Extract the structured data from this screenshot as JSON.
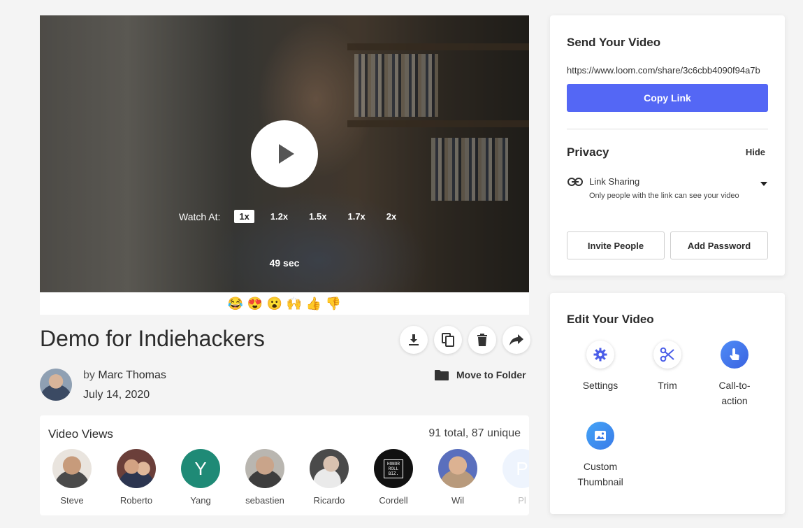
{
  "player": {
    "watch_at_label": "Watch At:",
    "speeds": [
      "1x",
      "1.2x",
      "1.5x",
      "1.7x",
      "2x"
    ],
    "active_speed": "1x",
    "duration": "49 sec"
  },
  "reactions": [
    "😂",
    "😍",
    "😮",
    "🙌",
    "👍",
    "👎"
  ],
  "video": {
    "title": "Demo for Indiehackers",
    "by_label": "by",
    "author": "Marc Thomas",
    "date": "July 14, 2020",
    "move_to_folder": "Move to Folder"
  },
  "views": {
    "title": "Video Views",
    "count": "91 total, 87 unique",
    "viewers": [
      {
        "name": "Steve",
        "initial": "",
        "color": "#b98a6a"
      },
      {
        "name": "Roberto",
        "initial": "",
        "color": "#6b3f3a"
      },
      {
        "name": "Yang",
        "initial": "Y",
        "color": "#1f8a76"
      },
      {
        "name": "sebastien",
        "initial": "",
        "color": "#8a8a86"
      },
      {
        "name": "Ricardo",
        "initial": "",
        "color": "#5a5a5a"
      },
      {
        "name": "Cordell",
        "initial": "HONOR ROLL BIZ.",
        "color": "#111111"
      },
      {
        "name": "Wil",
        "initial": "",
        "color": "#5a6fbd"
      },
      {
        "name": "Pl",
        "initial": "P",
        "color": "#cfe2fb"
      }
    ]
  },
  "send": {
    "title": "Send Your Video",
    "url": "https://www.loom.com/share/3c6cbb4090f94a7b",
    "copy_label": "Copy Link",
    "privacy_title": "Privacy",
    "hide_label": "Hide",
    "link_sharing_title": "Link Sharing",
    "link_sharing_desc": "Only people with the link can see your video",
    "invite_label": "Invite People",
    "password_label": "Add Password",
    "accent_color": "#5467f5"
  },
  "edit": {
    "title": "Edit Your Video",
    "tools": [
      {
        "label": "Settings",
        "icon": "gear-icon"
      },
      {
        "label": "Trim",
        "icon": "scissors-icon"
      },
      {
        "label": "Call-to-action",
        "icon": "tap-icon"
      },
      {
        "label": "Custom Thumbnail",
        "icon": "image-icon"
      }
    ]
  }
}
